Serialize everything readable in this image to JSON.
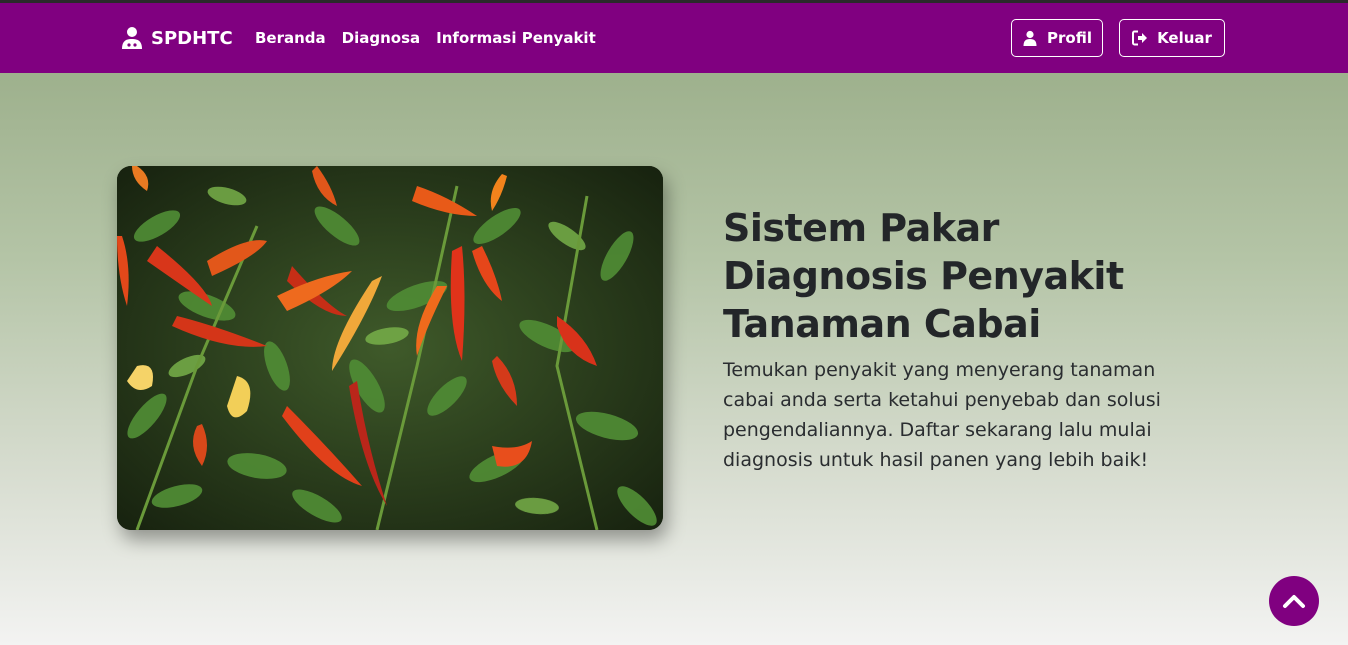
{
  "navbar": {
    "brand": "SPDHTC",
    "links": [
      "Beranda",
      "Diagnosa",
      "Informasi Penyakit"
    ],
    "profile_label": "Profil",
    "logout_label": "Keluar",
    "background_color": "#800080"
  },
  "hero": {
    "title": "Sistem Pakar Diagnosis Penyakit Tanaman Cabai",
    "description": "Temukan penyakit yang menyerang tanaman cabai anda serta ketahui penyebab dan solusi pengendaliannya. Daftar sekarang lalu mulai diagnosis untuk hasil panen yang lebih baik!",
    "image_icon": "chili-plant-photo"
  },
  "scroll_top": {
    "icon": "chevron-up-icon"
  }
}
